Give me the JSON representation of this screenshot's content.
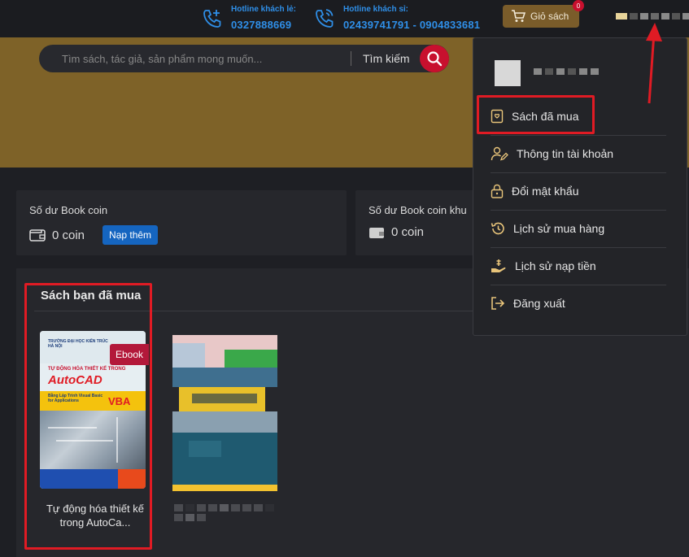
{
  "header": {
    "hotline_retail": {
      "label": "Hotline khách lẻ:",
      "number": "0327888669"
    },
    "hotline_wholesale": {
      "label": "Hotline khách sỉ:",
      "number": "02439741791 - 0904833681"
    },
    "cart": {
      "label": "Giỏ sách",
      "count": "0"
    }
  },
  "search": {
    "placeholder": "Tìm sách, tác giả, sản phẩm mong muốn...",
    "button_label": "Tìm kiếm"
  },
  "wallet": {
    "balance_title": "Số dư Book coin",
    "balance_value": "0 coin",
    "topup_label": "Nạp thêm",
    "promo_title": "Số dư Book coin khu",
    "promo_value": "0 coin"
  },
  "purchased": {
    "title": "Sách bạn đã mua",
    "books": [
      {
        "badge": "Ebook",
        "title": "Tự động hóa thiết kế trong AutoCa...",
        "cover": {
          "publisher": "TRƯỜNG ĐẠI HỌC KIẾN TRÚC HÀ NỘI",
          "subtitle": "TỰ ĐỘNG HÓA THIẾT KẾ TRONG",
          "headline": "AutoCAD",
          "tagline": "Bằng Lập Trình Visual Basic for Applications",
          "accent": "VBA"
        }
      }
    ]
  },
  "menu": {
    "items": [
      {
        "label": "Sách đã mua",
        "icon": "book-heart-icon"
      },
      {
        "label": "Thông tin tài khoản",
        "icon": "user-edit-icon"
      },
      {
        "label": "Đổi mật khẩu",
        "icon": "lock-icon"
      },
      {
        "label": "Lịch sử mua hàng",
        "icon": "history-icon"
      },
      {
        "label": "Lịch sử nạp tiền",
        "icon": "hand-coins-icon"
      },
      {
        "label": "Đăng xuất",
        "icon": "logout-icon"
      }
    ]
  },
  "colors": {
    "accent_red": "#e01b24",
    "link_blue": "#2f8fe8",
    "gold": "#7e6228"
  }
}
